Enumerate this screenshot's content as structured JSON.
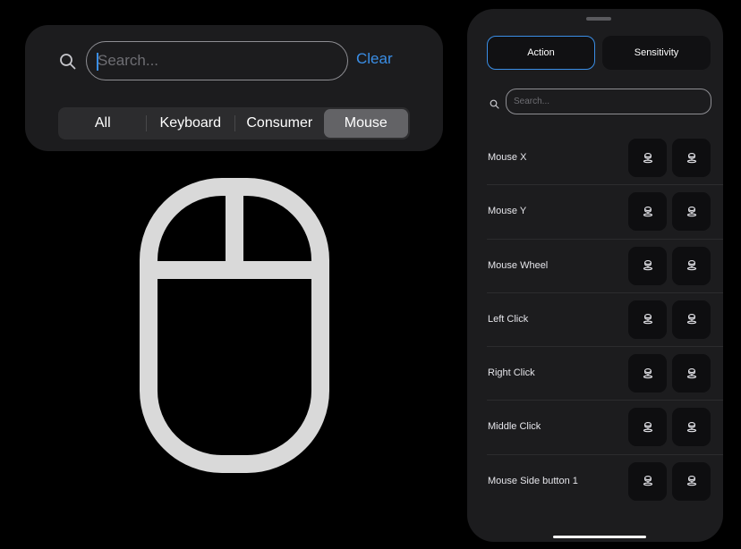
{
  "filter_panel": {
    "search": {
      "placeholder": "Search...",
      "value": ""
    },
    "clear_label": "Clear",
    "segments": [
      "All",
      "Keyboard",
      "Consumer",
      "Mouse"
    ],
    "selected_segment": "Mouse",
    "icon": "search-icon"
  },
  "preview": {
    "icon": "mouse-icon",
    "color": "#d9d9d9"
  },
  "sheet": {
    "tabs": [
      {
        "label": "Action",
        "active": true
      },
      {
        "label": "Sensitivity",
        "active": false
      }
    ],
    "search": {
      "placeholder": "Search...",
      "value": ""
    },
    "rows": [
      {
        "label": "Mouse X"
      },
      {
        "label": "Mouse Y"
      },
      {
        "label": "Mouse Wheel"
      },
      {
        "label": "Left Click"
      },
      {
        "label": "Right Click"
      },
      {
        "label": "Middle Click"
      },
      {
        "label": "Mouse Side button 1"
      }
    ],
    "row_button_icons": [
      "joystick-icon",
      "joystick-icon"
    ]
  },
  "colors": {
    "accent": "#3a8ee6",
    "panel": "#1c1c1e",
    "selected_segment": "#636366"
  }
}
